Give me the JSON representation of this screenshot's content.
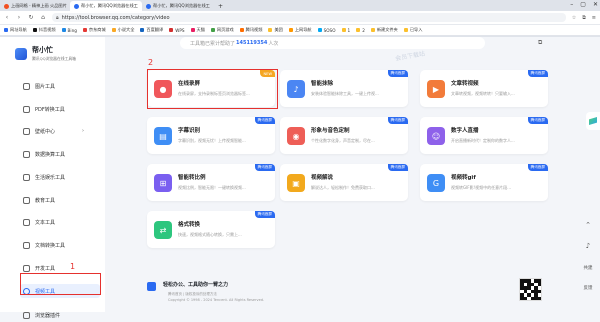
{
  "browser": {
    "tabs": [
      {
        "label": "上画网格 - 精神上画 火品图片",
        "color": "#f25022",
        "active": false
      },
      {
        "label": "帮小忙，腾讯QQ浏览器在线工",
        "color": "#2a6af1",
        "active": true
      },
      {
        "label": "帮小忙，腾讯QQ浏览器在线工",
        "color": "#2a6af1",
        "active": false
      }
    ],
    "url": "https://tool.browser.qq.com/category/video",
    "bookmarks": [
      "网址导航",
      "抖音视频",
      "Bing",
      "京东商城",
      "小说大全",
      "百度翻译",
      "WPS",
      "天猫",
      "网页游戏",
      "腾讯视频",
      "美团",
      "上网导航",
      "SOSO",
      "1",
      "2",
      "新建文件夹",
      "已导入"
    ]
  },
  "sidebar": {
    "brand": {
      "name": "帮小忙",
      "tagline": "腾讯QQ浏览器在线工具箱"
    },
    "items": [
      {
        "label": "图片工具",
        "icon": "image-icon",
        "active": false
      },
      {
        "label": "PDF转换工具",
        "icon": "pdf-icon",
        "active": false
      },
      {
        "label": "壁纸中心",
        "icon": "wallpaper-icon",
        "active": false,
        "expand": "›"
      },
      {
        "label": "数据换算工具",
        "icon": "data-icon",
        "active": false
      },
      {
        "label": "生活娱乐工具",
        "icon": "life-icon",
        "active": false
      },
      {
        "label": "教育工具",
        "icon": "edu-icon",
        "active": false
      },
      {
        "label": "文本工具",
        "icon": "text-icon",
        "active": false
      },
      {
        "label": "文档转换工具",
        "icon": "doc-icon",
        "active": false
      },
      {
        "label": "开发工具",
        "icon": "dev-icon",
        "active": false
      },
      {
        "label": "视频工具",
        "icon": "video-icon",
        "active": true
      },
      {
        "label": "浏览器插件",
        "icon": "plugin-icon",
        "active": false
      }
    ]
  },
  "annotations": {
    "one": "1",
    "two": "2"
  },
  "main": {
    "search": {
      "prefix": "工具箱已累计帮助了",
      "count": "145119354",
      "suffix": "人次"
    },
    "watermark": "会员下载站",
    "cards": [
      {
        "title": "在线录屏",
        "desc": "在线录屏，支持录制标签页浏览器标签...",
        "badge": "NEW",
        "badge_type": "new",
        "color": "#f0575b",
        "glyph": "●"
      },
      {
        "title": "智能抹除",
        "desc": "安装体验智能抹除工具，一键上传视...",
        "badge": "腾讯首屏",
        "badge_type": "blue",
        "color": "#4b86f3",
        "glyph": "♪"
      },
      {
        "title": "文章转视频",
        "desc": "文章转视频，视频转转！只要输入...",
        "badge": "腾讯首屏",
        "badge_type": "blue",
        "color": "#f27b3a",
        "glyph": "▶"
      },
      {
        "title": "字幕识别",
        "desc": "字幕识别，视频无忧！上传视频智能...",
        "badge": "腾讯首屏",
        "badge_type": "blue",
        "color": "#3f8ef5",
        "glyph": "▤"
      },
      {
        "title": "形象与音色定制",
        "desc": "个性化数字化身，声音定制，尽在...",
        "badge": "腾讯首屏",
        "badge_type": "blue",
        "color": "#ee5e57",
        "glyph": "◉"
      },
      {
        "title": "数字人直播",
        "desc": "开启直播新时代！定制你的数字人...",
        "badge": "腾讯首屏",
        "badge_type": "blue",
        "color": "#8e61ea",
        "glyph": "☺"
      },
      {
        "title": "智能转比例",
        "desc": "视频比例，智能无限！一键转换视频...",
        "badge": "腾讯首屏",
        "badge_type": "blue",
        "color": "#7a5ff0",
        "glyph": "⊞"
      },
      {
        "title": "视频解说",
        "desc": "解说达人，轻松制作！免费获取口...",
        "badge": "腾讯首屏",
        "badge_type": "blue",
        "color": "#f2a91d",
        "glyph": "▣"
      },
      {
        "title": "视频转gif",
        "desc": "视频转GIF影!视频中的任意片段...",
        "badge": "腾讯首屏",
        "badge_type": "blue",
        "color": "#3f8ef5",
        "glyph": "G"
      },
      {
        "title": "格式转换",
        "desc": "快速，视频格式随心转换，只需上...",
        "badge": "腾讯首屏",
        "badge_type": "blue",
        "color": "#2dc67e",
        "glyph": "⇄"
      }
    ],
    "right_tools": [
      {
        "label": "",
        "icon": "back-to-top-icon",
        "glyph": "⌃"
      },
      {
        "label": "",
        "icon": "bell-icon",
        "glyph": "♪"
      },
      {
        "label": "共建",
        "icon": "co-build-icon",
        "glyph": ""
      },
      {
        "label": "反馈",
        "icon": "feedback-icon",
        "glyph": ""
      }
    ],
    "footer": {
      "slogan": "轻松办公、工具助你一臂之力",
      "line1": "腾讯首页  |  版权投诉的处理方法",
      "line2": "Copyright © 1998 - 2024 Tencent. All Rights Reserved."
    }
  }
}
